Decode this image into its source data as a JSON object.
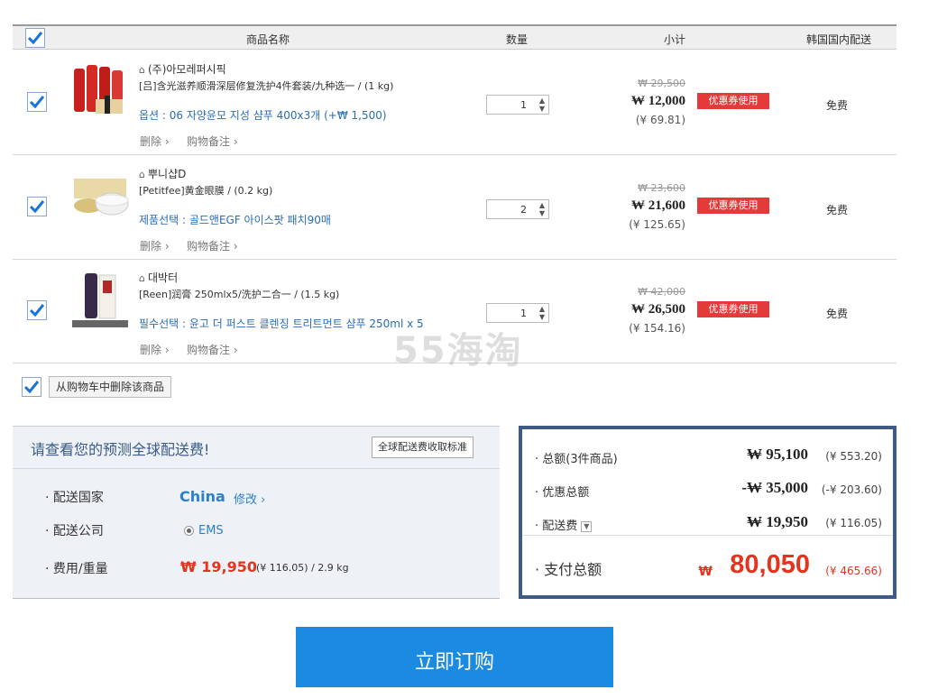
{
  "header": {
    "col_name": "商品名称",
    "col_qty": "数量",
    "col_subtotal": "小计",
    "col_delivery": "韩国国内配送"
  },
  "items": [
    {
      "store": "(주)아모레퍼시픽",
      "name": "[吕]含光滋养顺滑深层修复洗护4件套装/九种选一",
      "weight": "/  (1 kg)",
      "option": "옵션 : 06 자양윤모 지성 샴푸 400x3개 (+₩ 1,500)",
      "delete": "删除",
      "note": "购物备注",
      "qty": "1",
      "orig_price": "₩ 29,500",
      "price": "₩ 12,000",
      "cny": "(¥ 69.81)",
      "coupon": "优惠券使用",
      "delivery": "免费"
    },
    {
      "store": "뿌니샵D",
      "name": "[Petitfee]黄金眼膜",
      "weight": "/  (0.2 kg)",
      "option": "제품선택 : 골드앤EGF 아이스팟 패치90매",
      "delete": "删除",
      "note": "购物备注",
      "qty": "2",
      "orig_price": "₩ 23,600",
      "price": "₩ 21,600",
      "cny": "(¥ 125.65)",
      "coupon": "优惠券使用",
      "delivery": "免费"
    },
    {
      "store": "대박터",
      "name": "[Reen]润膏 250mlx5/洗护二合一",
      "weight": "/  (1.5 kg)",
      "option": "필수선택 : 윤고 더 퍼스트 클렌징 트리트먼트 샴푸 250ml x 5",
      "delete": "删除",
      "note": "购物备注",
      "qty": "1",
      "orig_price": "₩ 42,000",
      "price": "₩ 26,500",
      "cny": "(¥ 154.16)",
      "coupon": "优惠券使用",
      "delivery": "免费"
    }
  ],
  "delete_selected": "从购物车中删除该商品",
  "shipping": {
    "title": "请查看您的预测全球配送费!",
    "standard_button": "全球配送费收取标准",
    "country_label": "· 配送国家",
    "country": "China",
    "modify": "修改 ›",
    "carrier_label": "· 配送公司",
    "carrier": "EMS",
    "fee_label": "· 费用/重量",
    "fee": "₩ 19,950",
    "fee_detail": "(¥ 116.05) /  2.9 kg"
  },
  "totals": {
    "total_label": "· 总额(3件商品)",
    "total_value": "₩ 95,100",
    "total_cny": "(¥ 553.20)",
    "discount_label": "· 优惠总额",
    "discount_value": "-₩ 35,000",
    "discount_cny": "(-¥ 203.60)",
    "shipping_label": "· 配送费",
    "shipping_value": "₩ 19,950",
    "shipping_cny": "(¥ 116.05)",
    "pay_label": "· 支付总额",
    "pay_currency": "₩",
    "pay_value": "80,050",
    "pay_cny": "(¥ 465.66)"
  },
  "buy_button": "立即订购",
  "watermark": "55海淘",
  "colors": {
    "accent": "#1a8be0",
    "price_red": "#e4341e",
    "coupon_red": "#e43a3a",
    "frame_blue": "#3d5a88"
  }
}
